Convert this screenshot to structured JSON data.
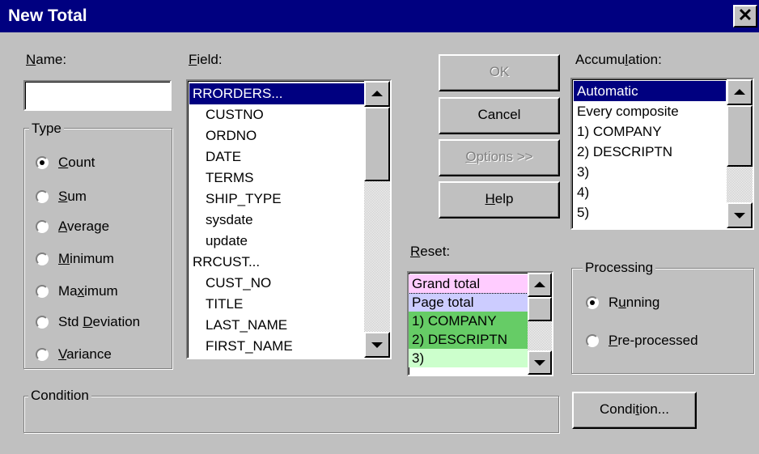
{
  "window": {
    "title": "New Total",
    "close_glyph": "✕"
  },
  "name_label_u": "N",
  "name_label_rest": "ame:",
  "name_value": "",
  "type_group": {
    "label": "Type",
    "options": [
      {
        "u": "C",
        "rest": "ount",
        "pre": "",
        "checked": true
      },
      {
        "u": "S",
        "rest": "um",
        "pre": "",
        "checked": false
      },
      {
        "u": "A",
        "rest": "verage",
        "pre": "",
        "checked": false
      },
      {
        "u": "M",
        "rest": "inimum",
        "pre": "",
        "checked": false
      },
      {
        "u": "x",
        "rest": "imum",
        "pre": "Ma",
        "checked": false
      },
      {
        "u": "D",
        "rest": "eviation",
        "pre": "Std ",
        "checked": false
      },
      {
        "u": "V",
        "rest": "ariance",
        "pre": "",
        "checked": false
      }
    ]
  },
  "field": {
    "label_u": "F",
    "label_rest": "ield:",
    "items": [
      {
        "text": "RRORDERS...",
        "indent": false,
        "selected": true
      },
      {
        "text": "CUSTNO",
        "indent": true,
        "selected": false
      },
      {
        "text": "ORDNO",
        "indent": true,
        "selected": false
      },
      {
        "text": "DATE",
        "indent": true,
        "selected": false
      },
      {
        "text": "TERMS",
        "indent": true,
        "selected": false
      },
      {
        "text": "SHIP_TYPE",
        "indent": true,
        "selected": false
      },
      {
        "text": "sysdate",
        "indent": true,
        "selected": false
      },
      {
        "text": "update",
        "indent": true,
        "selected": false
      },
      {
        "text": "RRCUST...",
        "indent": false,
        "selected": false
      },
      {
        "text": "CUST_NO",
        "indent": true,
        "selected": false
      },
      {
        "text": "TITLE",
        "indent": true,
        "selected": false
      },
      {
        "text": "LAST_NAME",
        "indent": true,
        "selected": false
      },
      {
        "text": "FIRST_NAME",
        "indent": true,
        "selected": false
      }
    ]
  },
  "buttons": {
    "ok": "OK",
    "cancel": "Cancel",
    "options_u": "O",
    "options_rest": "ptions >>",
    "help_u": "H",
    "help_rest": "elp",
    "condition_pre": "Condi",
    "condition_u": "t",
    "condition_rest": "ion..."
  },
  "reset": {
    "label_u": "R",
    "label_rest": "eset:",
    "items": [
      {
        "text": "Grand total",
        "color": "#ffccff"
      },
      {
        "text": "Page total",
        "color": "#ccccff"
      },
      {
        "text": "1) COMPANY",
        "color": "#66cc66"
      },
      {
        "text": "2) DESCRIPTN",
        "color": "#66cc66"
      },
      {
        "text": "3)",
        "color": "#ccffcc"
      }
    ]
  },
  "accumulation": {
    "label_pre": "Accumu",
    "label_u": "l",
    "label_rest": "ation:",
    "items": [
      {
        "text": "Automatic",
        "selected": true
      },
      {
        "text": "Every composite",
        "selected": false
      },
      {
        "text": "1) COMPANY",
        "selected": false
      },
      {
        "text": "2) DESCRIPTN",
        "selected": false
      },
      {
        "text": "3)",
        "selected": false
      },
      {
        "text": "4)",
        "selected": false
      },
      {
        "text": "5)",
        "selected": false
      }
    ]
  },
  "processing": {
    "label": "Processing",
    "running_pre": "R",
    "running_u": "u",
    "running_rest": "nning",
    "pre_u": "P",
    "pre_rest": "re-processed",
    "running_checked": true
  },
  "condition_group": {
    "label": "Condition"
  }
}
